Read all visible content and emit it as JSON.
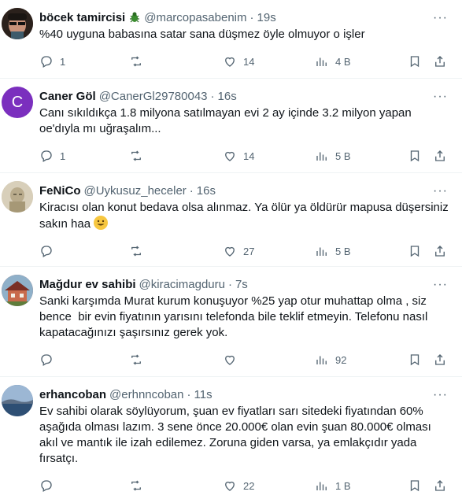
{
  "tweets": [
    {
      "name": "böcek tamircisi",
      "name_emoji": "bug-icon",
      "handle": "@marcopasabenim",
      "dot": "·",
      "time": "19s",
      "text": "%40 uyguna babasına satar sana düşmez öyle olmuyor o işler",
      "reply_count": "1",
      "retweet_count": "",
      "like_count": "14",
      "view_count": "4 B",
      "avatar_color": "#6b4a3a"
    },
    {
      "name": "Caner Göl",
      "handle": "@CanerGl29780043",
      "dot": "·",
      "time": "16s",
      "text": "Canı sıkıldıkça 1.8 milyona satılmayan evi 2 ay içinde 3.2 milyon yapan oe'dıyla mı uğraşalım...",
      "reply_count": "1",
      "retweet_count": "",
      "like_count": "14",
      "view_count": "5 B",
      "avatar_letter": "C",
      "avatar_color": "#7b2fbe"
    },
    {
      "name": "FeNiCo",
      "handle": "@Uykusuz_heceler",
      "dot": "·",
      "time": "16s",
      "text": "Kiracısı olan konut bedava olsa alınmaz. Ya ölür ya öldürür mapusa düşersiniz sakın haa",
      "reply_count": "",
      "retweet_count": "",
      "like_count": "27",
      "view_count": "5 B",
      "avatar_color": "#c9bda3"
    },
    {
      "name": "Mağdur ev sahibi",
      "handle": "@kiracimagduru",
      "dot": "·",
      "time": "7s",
      "text": "Sanki karşımda Murat kurum konuşuyor %25 yap otur muhattap olma , siz bence  bir evin fiyatının yarısını telefonda bile teklif etmeyin. Telefonu nasıl kapatacağınızı şaşırsınız gerek yok.",
      "reply_count": "",
      "retweet_count": "",
      "like_count": "",
      "view_count": "92",
      "avatar_color": "#9a4b3c"
    },
    {
      "name": "erhancoban",
      "handle": "@erhnncoban",
      "dot": "·",
      "time": "11s",
      "text": "Ev sahibi olarak söylüyorum, şuan ev fiyatları sarı sitedeki fiyatından 60% aşağıda olması lazım. 3 sene önce 20.000€ olan evin şuan 80.000€ olması akıl ve mantık ile izah edilemez. Zoruna giden varsa, ya emlakçıdır yada fırsatçı.",
      "reply_count": "",
      "retweet_count": "",
      "like_count": "22",
      "view_count": "1 B",
      "avatar_color": "#3b5f8a"
    }
  ],
  "icons": {
    "more": "more-icon",
    "reply": "reply-icon",
    "retweet": "retweet-icon",
    "like": "like-icon",
    "views": "views-icon",
    "bookmark": "bookmark-icon",
    "share": "share-icon"
  },
  "text_emoji": "grinning-face-icon"
}
